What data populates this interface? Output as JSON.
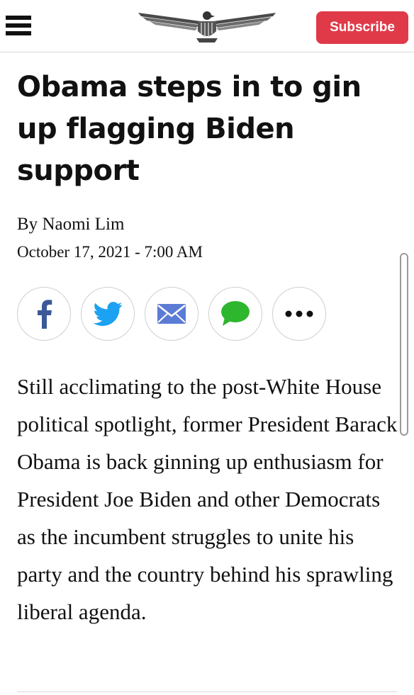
{
  "header": {
    "menu_icon": "hamburger-menu-icon",
    "logo_icon": "eagle-seal-logo",
    "subscribe_label": "Subscribe",
    "subscribe_color": "#e03a48"
  },
  "article": {
    "headline": "Obama steps in to gin up flagging Biden support",
    "byline_prefix": "By",
    "author": "Naomi Lim",
    "date": "October 17, 2021 - 7:00 AM",
    "body": "Still acclimating to the post-White House political spotlight, former President Barack Obama is back ginning up enthusiasm for President Joe Biden and other Democrats as the incumbent struggles to unite his party and the country behind his sprawling liberal agenda."
  },
  "share": {
    "buttons": [
      {
        "icon": "facebook-icon",
        "color": "#3b5998"
      },
      {
        "icon": "twitter-icon",
        "color": "#1da1f2"
      },
      {
        "icon": "email-icon",
        "color": "#5b7bd5"
      },
      {
        "icon": "sms-icon",
        "color": "#2fb62f"
      },
      {
        "icon": "more-icon",
        "color": "#111111"
      }
    ]
  }
}
